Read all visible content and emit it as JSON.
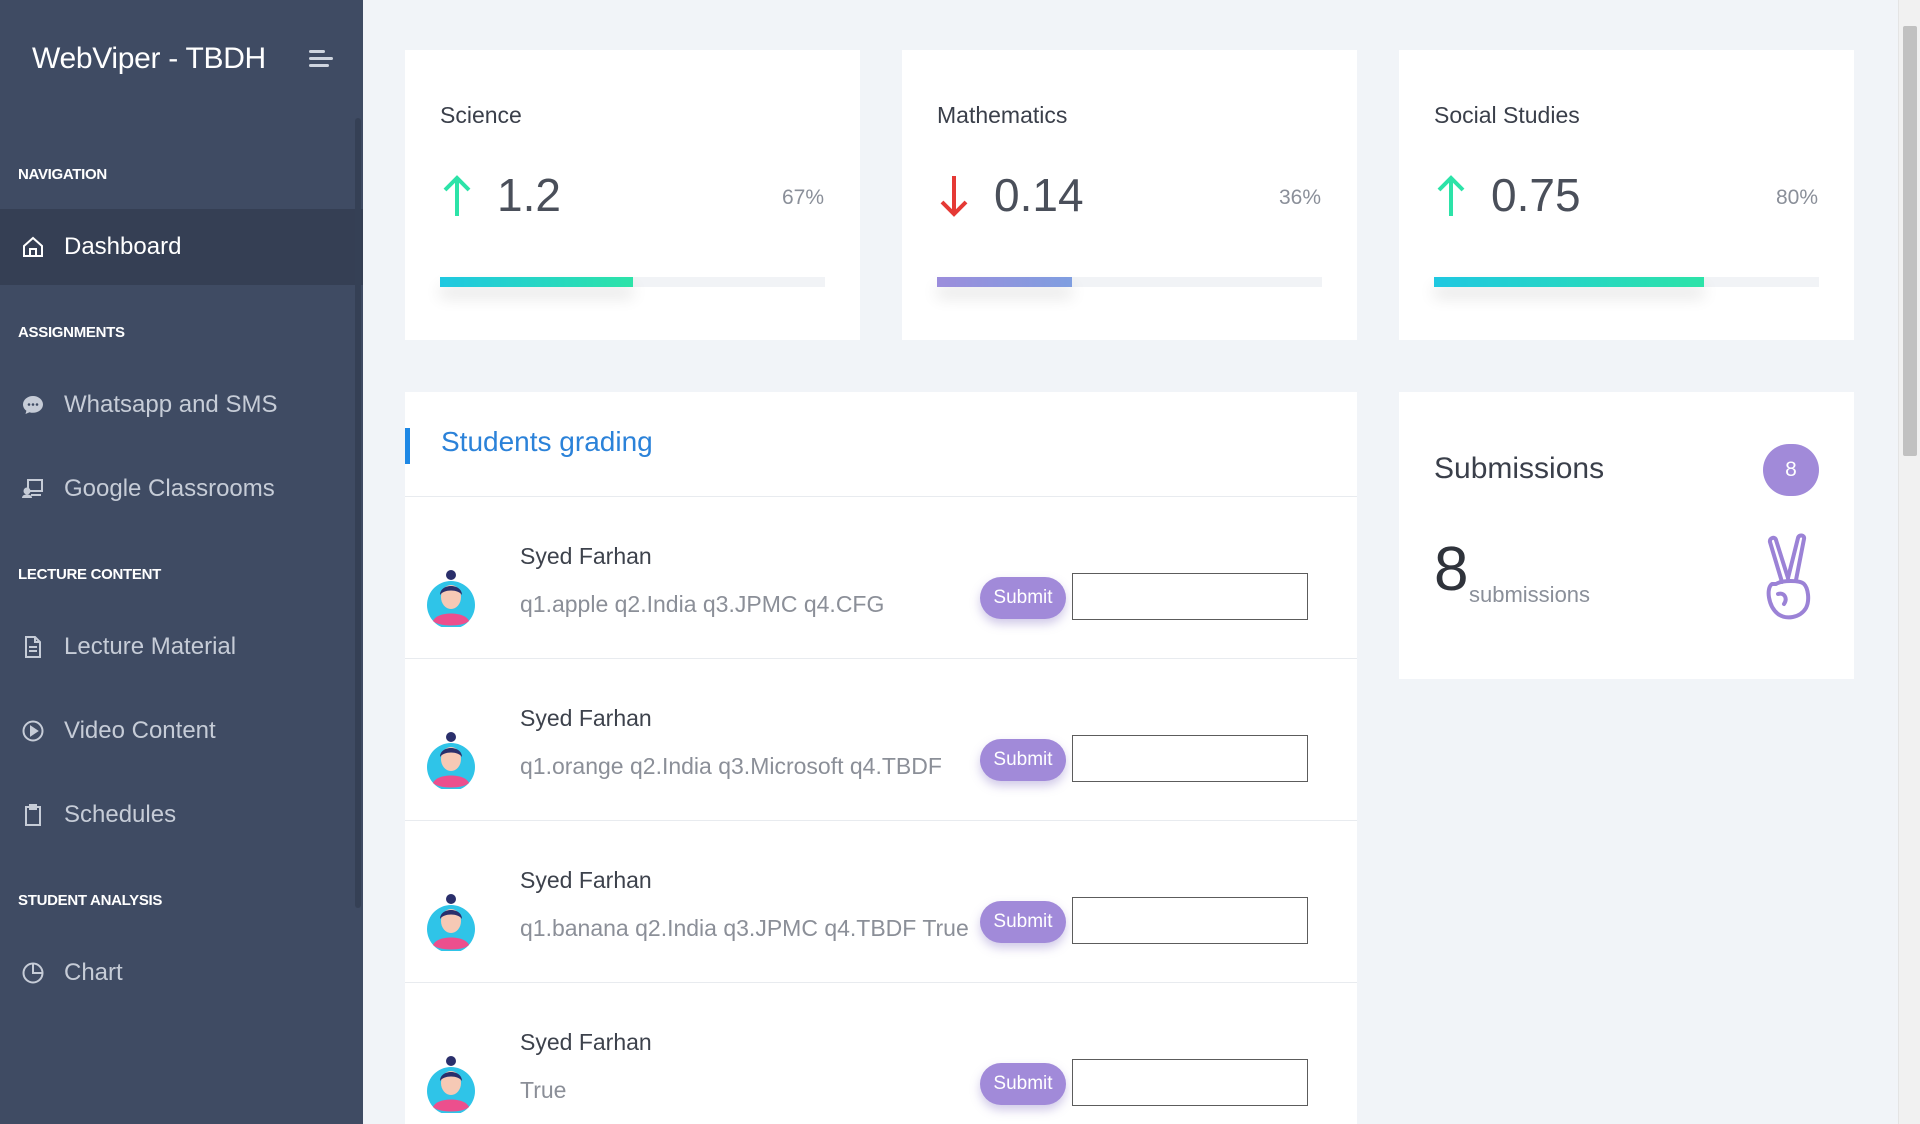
{
  "app": {
    "title": "WebViper - TBDH"
  },
  "sidebar": {
    "sections": {
      "navigation": "NAVIGATION",
      "assignments": "ASSIGNMENTS",
      "lecture": "LECTURE CONTENT",
      "analysis": "STUDENT ANALYSIS"
    },
    "items": {
      "dashboard": "Dashboard",
      "whatsapp": "Whatsapp and SMS",
      "classrooms": "Google Classrooms",
      "lecture_material": "Lecture Material",
      "video": "Video Content",
      "schedules": "Schedules",
      "chart": "Chart"
    }
  },
  "stats": [
    {
      "title": "Science",
      "value": "1.2",
      "trend": "up",
      "percent": "67%",
      "progress": 0.5,
      "color_from": "#1fc8e1",
      "color_to": "#2ce3a8"
    },
    {
      "title": "Mathematics",
      "value": "0.14",
      "trend": "down",
      "percent": "36%",
      "progress": 0.35,
      "color_from": "#9b8ddc",
      "color_to": "#7f9ee0"
    },
    {
      "title": "Social Studies",
      "value": "0.75",
      "trend": "up",
      "percent": "80%",
      "progress": 0.7,
      "color_from": "#1fc8e1",
      "color_to": "#2ce3a8"
    }
  ],
  "grading": {
    "title": "Students grading",
    "submit_label": "Submit",
    "rows": [
      {
        "name": "Syed Farhan",
        "answers": "q1.apple q2.India q3.JPMC q4.CFG"
      },
      {
        "name": "Syed Farhan",
        "answers": "q1.orange q2.India q3.Microsoft q4.TBDF"
      },
      {
        "name": "Syed Farhan",
        "answers": "q1.banana q2.India q3.JPMC q4.TBDF True"
      },
      {
        "name": "Syed Farhan",
        "answers": "True"
      }
    ]
  },
  "submissions": {
    "title": "Submissions",
    "badge": "8",
    "count": "8",
    "unit": "submissions"
  },
  "colors": {
    "accent": "#a18ad9",
    "sidebar": "#3f4b63",
    "up": "#2ce3a8",
    "down": "#e53935"
  }
}
